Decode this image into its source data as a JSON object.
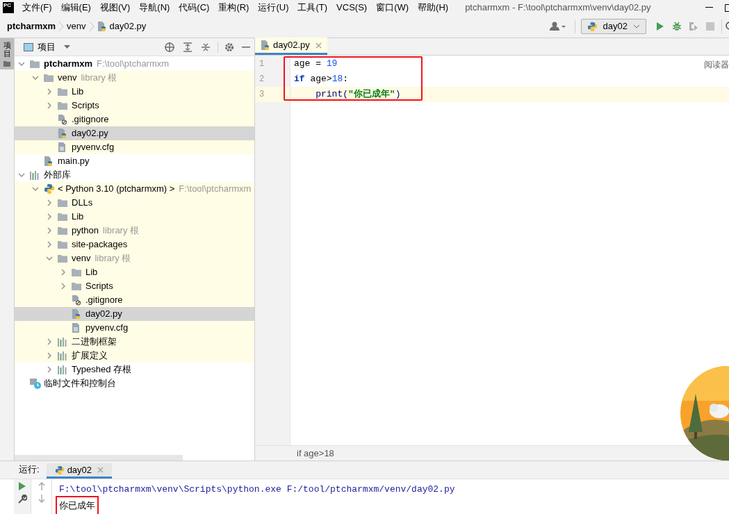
{
  "app_logo": "PC",
  "menu": [
    "文件(F)",
    "编辑(E)",
    "视图(V)",
    "导航(N)",
    "代码(C)",
    "重构(R)",
    "运行(U)",
    "工具(T)",
    "VCS(S)",
    "窗口(W)",
    "帮助(H)"
  ],
  "window": {
    "title": "ptcharmxm - F:\\tool\\ptcharmxm\\venv\\day02.py"
  },
  "breadcrumb": [
    {
      "label": "ptcharmxm",
      "kind": "project"
    },
    {
      "label": "venv",
      "kind": "folder"
    },
    {
      "label": "day02.py",
      "kind": "python-file"
    }
  ],
  "run_config": {
    "label": "day02"
  },
  "toolbar": [
    {
      "kind": "run",
      "disabled": false
    },
    {
      "kind": "debug",
      "disabled": false
    },
    {
      "kind": "coverage",
      "disabled": true
    },
    {
      "kind": "stop",
      "disabled": true
    }
  ],
  "side_tab": {
    "label": "项目",
    "selected": true
  },
  "project_panel": {
    "title": "项目",
    "tree": [
      {
        "label": "ptcharmxm",
        "hint": "F:\\tool\\ptcharmxm",
        "kind": "project",
        "expanded": true,
        "selected": false,
        "library": false,
        "children": [
          {
            "label": "venv",
            "hint": "library 根",
            "kind": "folder",
            "expanded": true,
            "selected": false,
            "library": true,
            "children": [
              {
                "label": "Lib",
                "kind": "folder",
                "expanded": false,
                "selected": false,
                "library": true
              },
              {
                "label": "Scripts",
                "kind": "folder",
                "expanded": false,
                "selected": false,
                "library": true
              },
              {
                "label": ".gitignore",
                "kind": "ignore-file",
                "selected": false,
                "library": true
              },
              {
                "label": "day02.py",
                "kind": "python-file",
                "selected": true
              },
              {
                "label": "pyvenv.cfg",
                "kind": "text-file",
                "selected": false,
                "library": true
              }
            ]
          },
          {
            "label": "main.py",
            "kind": "python-file",
            "selected": false,
            "library": false
          }
        ]
      },
      {
        "label": "外部库",
        "kind": "library",
        "expanded": true,
        "selected": false,
        "library": false,
        "children": [
          {
            "label": "< Python 3.10 (ptcharmxm) >",
            "hint": "F:\\tool\\ptcharmxm",
            "kind": "sdk",
            "expanded": true,
            "selected": false,
            "library": true,
            "children": [
              {
                "label": "DLLs",
                "kind": "folder",
                "expanded": false,
                "selected": false,
                "library": true
              },
              {
                "label": "Lib",
                "kind": "folder",
                "expanded": false,
                "selected": false,
                "library": true
              },
              {
                "label": "python",
                "hint": "library 根",
                "kind": "folder",
                "expanded": false,
                "selected": false,
                "library": true
              },
              {
                "label": "site-packages",
                "kind": "folder",
                "expanded": false,
                "selected": false,
                "library": true
              },
              {
                "label": "venv",
                "hint": "library 根",
                "kind": "folder",
                "expanded": true,
                "selected": false,
                "library": true,
                "children": [
                  {
                    "label": "Lib",
                    "kind": "folder",
                    "expanded": false,
                    "selected": false,
                    "library": true
                  },
                  {
                    "label": "Scripts",
                    "kind": "folder",
                    "expanded": false,
                    "selected": false,
                    "library": true
                  },
                  {
                    "label": ".gitignore",
                    "kind": "ignore-file",
                    "selected": false,
                    "library": true
                  },
                  {
                    "label": "day02.py",
                    "kind": "python-file",
                    "selected": true
                  },
                  {
                    "label": "pyvenv.cfg",
                    "kind": "text-file",
                    "selected": false,
                    "library": true
                  }
                ]
              },
              {
                "label": "二进制框架",
                "kind": "library",
                "expanded": false,
                "selected": false,
                "library": true
              },
              {
                "label": "扩展定义",
                "kind": "library",
                "expanded": false,
                "selected": false,
                "library": true
              },
              {
                "label": "Typeshed 存根",
                "kind": "library",
                "expanded": false,
                "selected": false,
                "library": false
              }
            ]
          }
        ]
      },
      {
        "label": "临时文件和控制台",
        "kind": "scratch",
        "selected": false,
        "library": false
      }
    ]
  },
  "editor": {
    "tabs": [
      {
        "label": "day02.py",
        "selected": true
      }
    ],
    "reader_mode": "阅读器",
    "highlighted": true,
    "lines": [
      {
        "number": "1",
        "current": false,
        "tokens": [
          {
            "text": "age = ",
            "kind": "plain"
          },
          {
            "text": "19",
            "kind": "number"
          }
        ]
      },
      {
        "number": "2",
        "current": false,
        "tokens": [
          {
            "text": "if",
            "kind": "keyword"
          },
          {
            "text": " age>",
            "kind": "plain"
          },
          {
            "text": "18",
            "kind": "number"
          },
          {
            "text": ":",
            "kind": "plain"
          }
        ]
      },
      {
        "number": "3",
        "current": true,
        "tokens": [
          {
            "text": "    print(",
            "kind": "builtin"
          },
          {
            "text": "\"你已成年\"",
            "kind": "string"
          },
          {
            "text": ")",
            "kind": "builtin"
          }
        ]
      }
    ],
    "breadcrumb": "if age>18"
  },
  "run_panel": {
    "label": "运行:",
    "tabs": [
      {
        "label": "day02",
        "selected": true
      }
    ],
    "output": [
      {
        "text": "F:\\tool\\ptcharmxm\\venv\\Scripts\\python.exe F:/tool/ptcharmxm/venv/day02.py",
        "kind": "command",
        "highlighted": false
      },
      {
        "text": "你已成年",
        "kind": "stdout",
        "highlighted": true
      }
    ]
  }
}
